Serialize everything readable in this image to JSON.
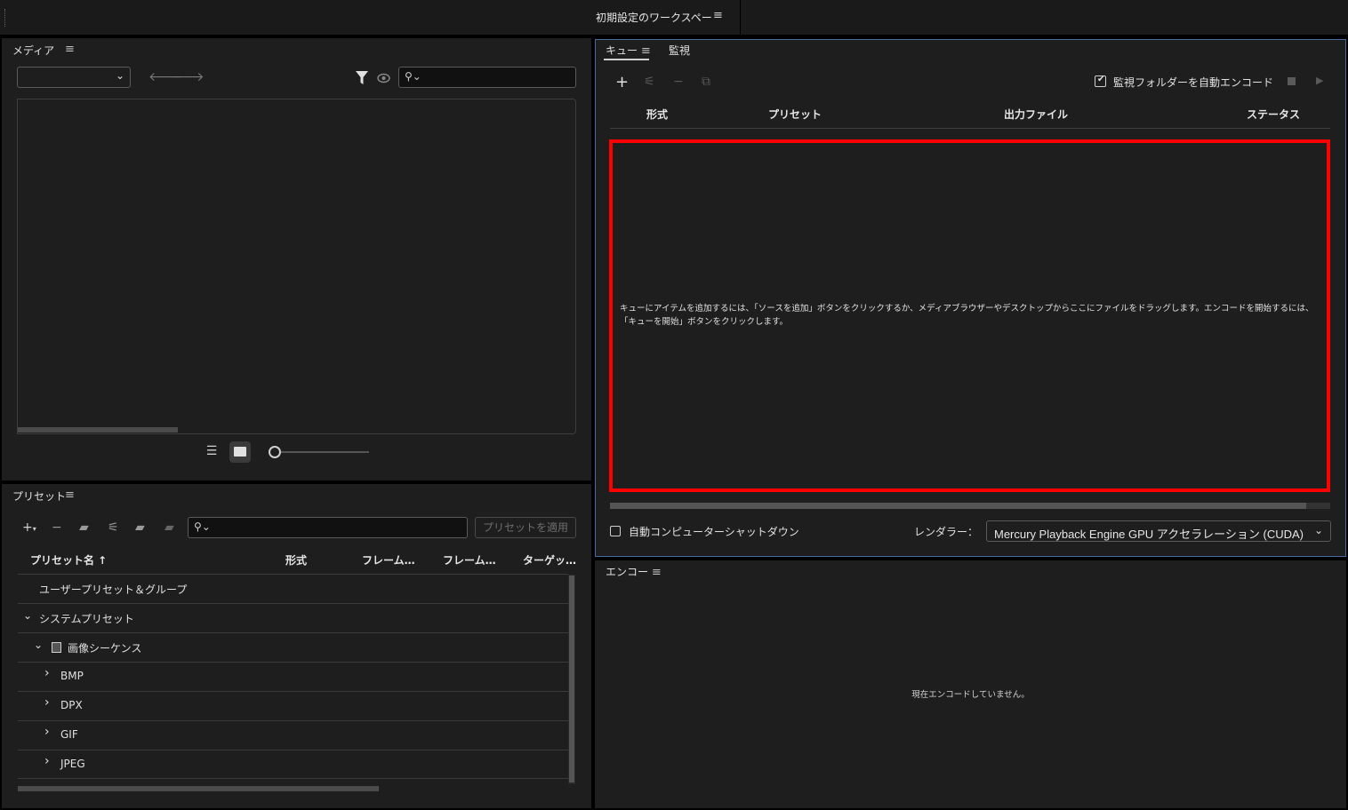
{
  "workspace": {
    "title": "初期設定のワークスペー",
    "menu_icon": "≡"
  },
  "media": {
    "title": "メディア",
    "menu_icon": "≡",
    "select_value": "",
    "search_placeholder": "",
    "icons": [
      "back-arrow-icon",
      "forward-arrow-icon",
      "filter-icon",
      "eye-icon",
      "search-icon",
      "list-view-icon",
      "thumbnail-view-icon"
    ]
  },
  "preset": {
    "title": "プリセット",
    "menu_icon": "≡",
    "apply_label": "プリセットを適用",
    "columns": [
      "プリセット名 ↑",
      "形式",
      "フレーム…",
      "フレーム…",
      "ターゲッ…"
    ],
    "rows": [
      {
        "label": "ユーザープリセット＆グループ",
        "chevron": "",
        "indent": 0
      },
      {
        "label": "システムプリセット",
        "chevron": "⌄",
        "indent": 0
      },
      {
        "label": "画像シーケンス",
        "chevron": "⌄",
        "indent": 1
      },
      {
        "label": "BMP",
        "chevron": "›",
        "indent": 2
      },
      {
        "label": "DPX",
        "chevron": "›",
        "indent": 2
      },
      {
        "label": "GIF",
        "chevron": "›",
        "indent": 2
      },
      {
        "label": "JPEG",
        "chevron": "›",
        "indent": 2
      }
    ]
  },
  "queue": {
    "tab_queue": "キュー",
    "tab_monitor": "監視",
    "menu_icon": "≡",
    "auto_encode_label": "監視フォルダーを自動エンコード",
    "auto_encode_checked": true,
    "columns": {
      "format": "形式",
      "preset": "プリセット",
      "output": "出力ファイル",
      "status": "ステータス"
    },
    "drop_message": "キューにアイテムを追加するには、「ソースを追加」ボタンをクリックするか、メディアブラウザーやデスクトップからここにファイルをドラッグします。エンコードを開始するには、「キューを開始」ボタンをクリックします。",
    "shutdown_label": "自動コンピューターシャットダウン",
    "renderer_label": "レンダラー：",
    "renderer_value": "Mercury Playback Engine GPU アクセラレーション (CUDA)",
    "highlight_color": "#ff0000"
  },
  "encode": {
    "title": "エンコー",
    "menu_icon": "≡",
    "status_message": "現在エンコードしていません。"
  }
}
